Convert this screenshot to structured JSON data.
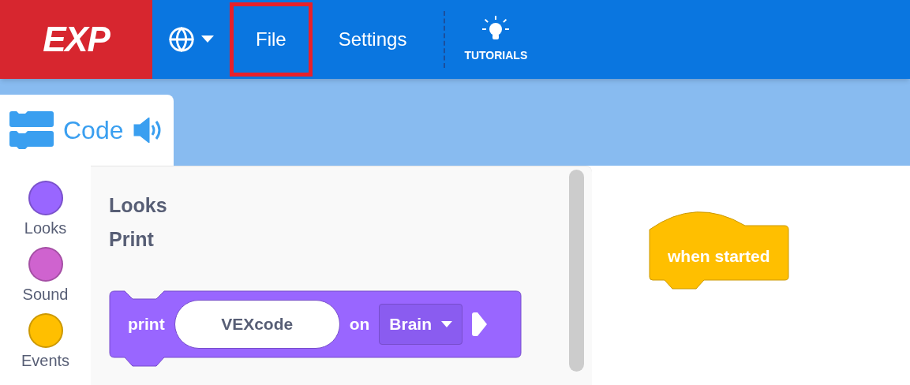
{
  "header": {
    "logo": "EXP",
    "menu": [
      {
        "label": "File",
        "highlighted": true
      },
      {
        "label": "Settings",
        "highlighted": false
      }
    ],
    "tutorials": "TUTORIALS"
  },
  "tabs": [
    {
      "label": "Code",
      "selected": true
    }
  ],
  "categories": [
    {
      "name": "Looks",
      "color": "#9966ff"
    },
    {
      "name": "Sound",
      "color": "#cf63cf"
    },
    {
      "name": "Events",
      "color": "#ffbf00"
    }
  ],
  "palette": {
    "headings": [
      "Looks",
      "Print"
    ],
    "block": {
      "label": "print",
      "input": "VEXcode",
      "connector": "on",
      "dropdown": "Brain"
    }
  },
  "workspace": {
    "hat_block": "when started"
  }
}
